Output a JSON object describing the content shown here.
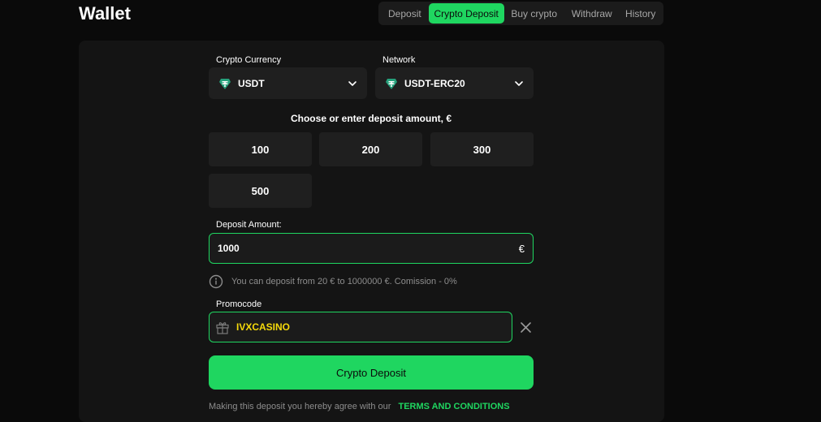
{
  "header": {
    "title": "Wallet"
  },
  "tabs": [
    {
      "label": "Deposit",
      "active": false
    },
    {
      "label": "Crypto Deposit",
      "active": true
    },
    {
      "label": "Buy crypto",
      "active": false
    },
    {
      "label": "Withdraw",
      "active": false
    },
    {
      "label": "History",
      "active": false
    }
  ],
  "form": {
    "currency": {
      "label": "Crypto Currency",
      "value": "USDT",
      "icon": "tether-icon"
    },
    "network": {
      "label": "Network",
      "value": "USDT-ERC20",
      "icon": "tether-icon"
    },
    "amount_heading": "Choose or enter deposit amount, €",
    "amount_options": [
      "100",
      "200",
      "300",
      "500"
    ],
    "deposit_amount": {
      "label": "Deposit Amount:",
      "value": "1000",
      "currency_symbol": "€"
    },
    "info_text": "You can deposit from 20 € to 1000000 €. Comission - 0%",
    "promocode": {
      "label": "Promocode",
      "value": "IVXCASINO",
      "icon": "gift-icon"
    },
    "submit_label": "Crypto Deposit",
    "terms_text": "Making this deposit you hereby agree with our",
    "terms_link": "TERMS AND CONDITIONS"
  },
  "colors": {
    "accent": "#1fd660",
    "promo_text": "#f5d90a",
    "background": "#0a0a0a",
    "panel": "#141414",
    "field": "#1f1f1f"
  }
}
